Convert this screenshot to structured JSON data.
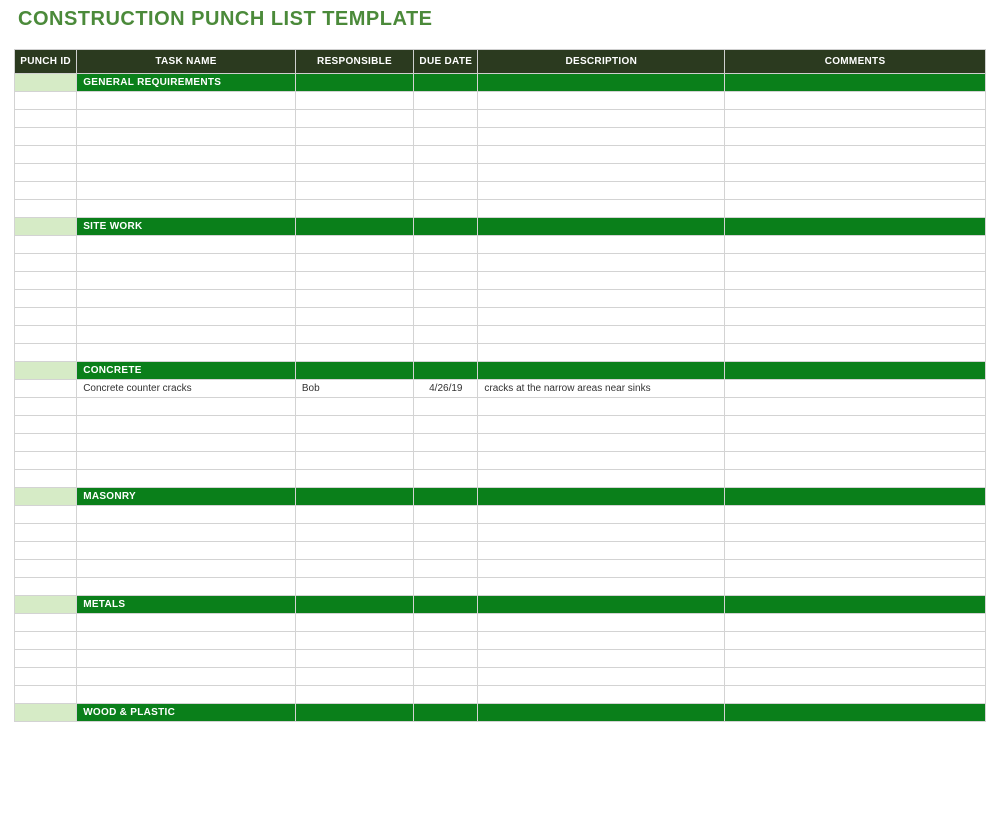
{
  "title": "CONSTRUCTION PUNCH LIST TEMPLATE",
  "columns": {
    "punch_id": "PUNCH ID",
    "task_name": "TASK NAME",
    "responsible": "RESPONSIBLE",
    "due_date": "DUE DATE",
    "description": "DESCRIPTION",
    "comments": "COMMENTS"
  },
  "sections": [
    {
      "name": "GENERAL REQUIREMENTS",
      "blank_rows": 7
    },
    {
      "name": "SITE WORK",
      "blank_rows": 7
    },
    {
      "name": "CONCRETE",
      "data_rows": [
        {
          "punch_id": "",
          "task_name": "Concrete counter cracks",
          "responsible": "Bob",
          "due_date": "4/26/19",
          "description": "cracks at the narrow areas near sinks",
          "comments": ""
        }
      ],
      "blank_rows": 5
    },
    {
      "name": "MASONRY",
      "blank_rows": 5
    },
    {
      "name": "METALS",
      "blank_rows": 5
    },
    {
      "name": "WOOD & PLASTIC",
      "blank_rows": 0
    }
  ]
}
